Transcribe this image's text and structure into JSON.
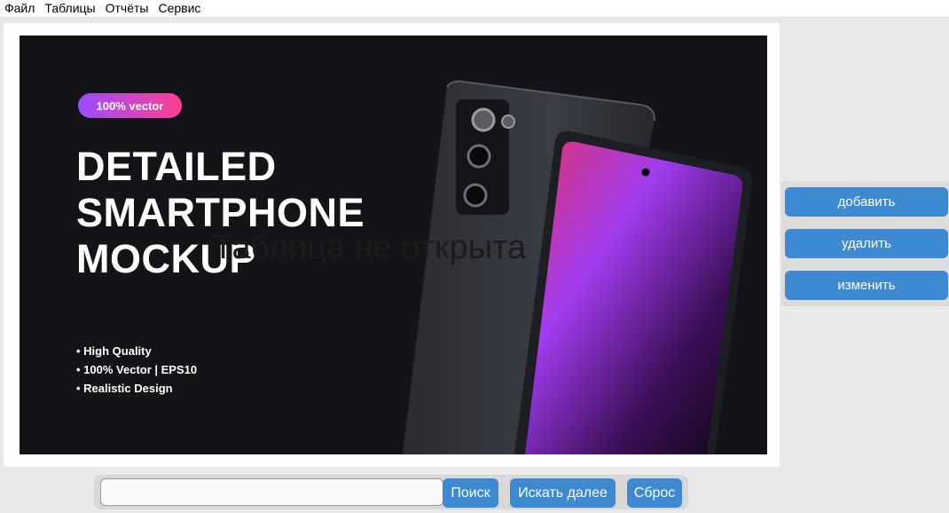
{
  "menu": {
    "file": "Файл",
    "tables": "Таблицы",
    "reports": "Отчёты",
    "service": "Сервис"
  },
  "banner": {
    "badge": "100% vector",
    "headline": [
      "DETAILED",
      "SMARTPHONE",
      "MOCKUP"
    ],
    "features": [
      "• High Quality",
      "• 100% Vector | EPS10",
      "• Realistic Design"
    ]
  },
  "overlay_message": "Таблица не открыта",
  "side_buttons": {
    "add": "добавить",
    "delete": "удалить",
    "edit": "изменить"
  },
  "search": {
    "value": "",
    "placeholder": "",
    "search_label": "Поиск",
    "search_next_label": "Искать далее",
    "reset_label": "Сброс"
  },
  "colors": {
    "button_blue": "#3e8ad2",
    "banner_bg": "#141418",
    "badge_gradient": [
      "#9a4cff",
      "#ff3f8e"
    ]
  }
}
